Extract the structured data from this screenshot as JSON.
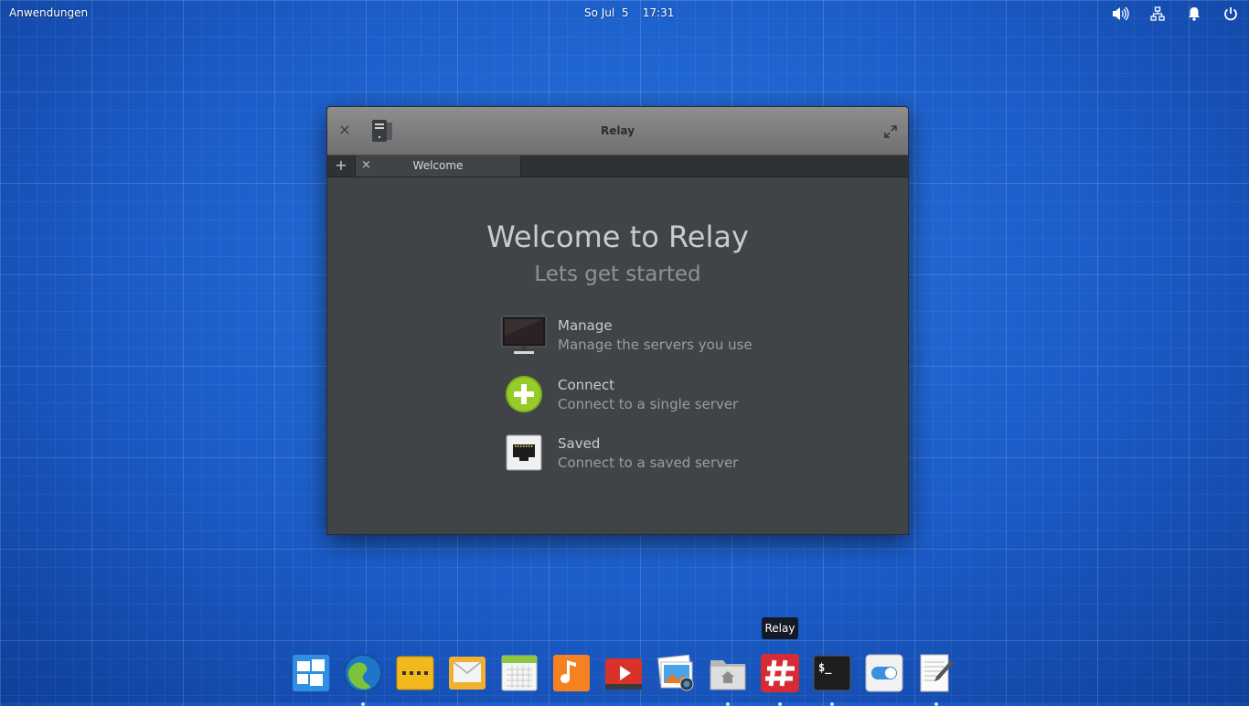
{
  "panel": {
    "applications_label": "Anwendungen",
    "date": "So Jul  5",
    "time": "17:31",
    "indicators": [
      "volume-icon",
      "network-icon",
      "notifications-icon",
      "power-icon"
    ]
  },
  "window": {
    "title": "Relay",
    "new_tab_symbol": "+",
    "close_symbol": "×",
    "tabs": [
      {
        "label": "Welcome"
      }
    ],
    "welcome": {
      "heading": "Welcome to Relay",
      "subheading": "Lets get started",
      "options": [
        {
          "title": "Manage",
          "description": "Manage the servers you use",
          "icon": "monitor-icon"
        },
        {
          "title": "Connect",
          "description": "Connect to a single server",
          "icon": "add-circle-icon"
        },
        {
          "title": "Saved",
          "description": "Connect to a saved server",
          "icon": "network-port-icon"
        }
      ]
    }
  },
  "dock": {
    "tooltip": "Relay",
    "items": [
      {
        "name": "multitasking-view",
        "running": false
      },
      {
        "name": "web-browser",
        "running": true
      },
      {
        "name": "taxi-ftp",
        "running": false
      },
      {
        "name": "mail",
        "running": false
      },
      {
        "name": "calendar",
        "running": false
      },
      {
        "name": "music",
        "running": false
      },
      {
        "name": "videos",
        "running": false
      },
      {
        "name": "photos",
        "running": false
      },
      {
        "name": "files",
        "running": true
      },
      {
        "name": "relay",
        "running": true
      },
      {
        "name": "terminal",
        "running": true
      },
      {
        "name": "system-settings",
        "running": false
      },
      {
        "name": "text-editor",
        "running": true
      }
    ]
  },
  "colors": {
    "desktop": "#1a5cc4",
    "window_bg": "#404447",
    "relay_red": "#d62a35",
    "connect_green": "#8ec21f"
  }
}
